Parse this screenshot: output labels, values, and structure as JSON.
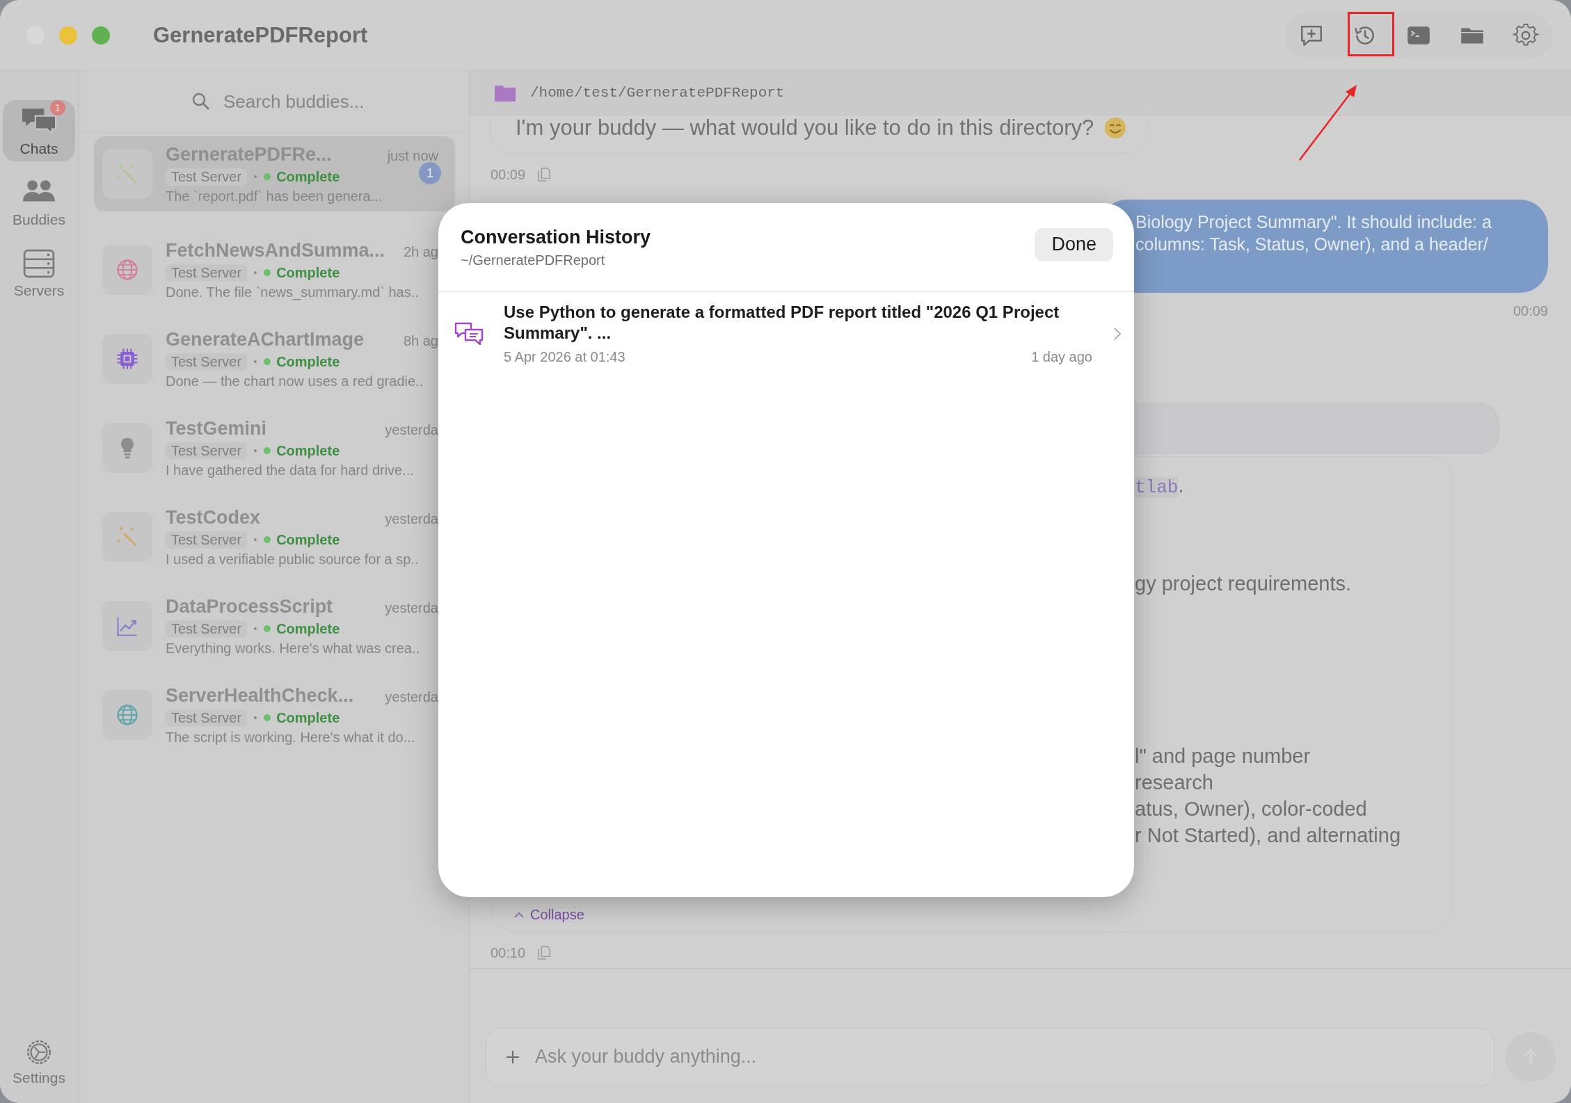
{
  "window": {
    "title": "GerneratePDFReport"
  },
  "nav": [
    {
      "kind": "chats",
      "label": "Chats",
      "selected": true,
      "badge": "1"
    },
    {
      "kind": "buddies",
      "label": "Buddies",
      "selected": false
    },
    {
      "kind": "servers",
      "label": "Servers",
      "selected": false
    }
  ],
  "settings": {
    "label": "Settings"
  },
  "search": {
    "placeholder": "Search buddies..."
  },
  "chats": [
    {
      "kind": "wand",
      "color": "#a9c98f",
      "title": "GerneratePDFRe...",
      "time": "just now",
      "server": "Test Server",
      "status": "Complete",
      "preview": "The `report.pdf` has been genera...",
      "selected": true,
      "badge": "1"
    },
    {
      "kind": "globe",
      "color": "#d37f9f",
      "title": "FetchNewsAndSumma...",
      "time": "2h ag",
      "server": "Test Server",
      "status": "Complete",
      "preview": "Done. The file `news_summary.md` has..",
      "selected": false
    },
    {
      "kind": "chip",
      "color": "#8a5fcf",
      "title": "GenerateAChartImage",
      "time": "8h ag",
      "server": "Test Server",
      "status": "Complete",
      "preview": "Done — the chart now uses a red gradie..",
      "selected": false
    },
    {
      "kind": "bulb",
      "color": "#8d8d8d",
      "title": "TestGemini",
      "time": "yesterda",
      "server": "Test Server",
      "status": "Complete",
      "preview": "I have gathered the data for hard drive...",
      "selected": false
    },
    {
      "kind": "wand",
      "color": "#d9a35b",
      "title": "TestCodex",
      "time": "yesterda",
      "server": "Test Server",
      "status": "Complete",
      "preview": "I used a verifiable public source for a sp..",
      "selected": false
    },
    {
      "kind": "chart",
      "color": "#7f82c9",
      "title": "DataProcessScript",
      "time": "yesterda",
      "server": "Test Server",
      "status": "Complete",
      "preview": "Everything works. Here's what was crea..",
      "selected": false
    },
    {
      "kind": "globe",
      "color": "#5fa6ad",
      "title": "ServerHealthCheck...",
      "time": "yesterda",
      "server": "Test Server",
      "status": "Complete",
      "preview": "The script is working. Here's what it do...",
      "selected": false
    }
  ],
  "chat": {
    "path": "/home/test/GerneratePDFReport",
    "greeting": {
      "text": "I'm your buddy — what would you like to do in this directory?",
      "time": "00:09"
    },
    "user_message": {
      "lines": [
        "Biology Project Summary\". It should include: a",
        "columns: Task, Status, Owner), and a header/"
      ],
      "time": "00:09"
    },
    "reply": {
      "code": "tlab",
      "code_after": ".",
      "lines": [
        "gy project requirements.",
        "l\" and page number",
        "research",
        "atus, Owner), color-coded",
        "r Not Started), and alternating"
      ],
      "collapse": "Collapse",
      "time": "00:10"
    },
    "input": {
      "placeholder": "Ask your buddy anything..."
    }
  },
  "modal": {
    "title": "Conversation History",
    "subtitle": "~/GerneratePDFReport",
    "done": "Done",
    "rows": [
      {
        "text": "Use Python to generate a formatted PDF report titled \"2026 Q1 Project Summary\". ...",
        "date": "5 Apr 2026 at 01:43",
        "ago": "1 day ago"
      }
    ]
  }
}
